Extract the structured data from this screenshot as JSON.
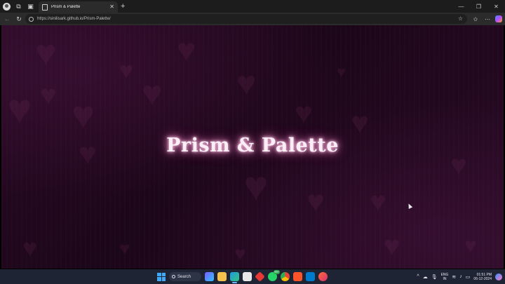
{
  "browser": {
    "tab_title": "Prism & Palette",
    "tab_favicon": "page-icon",
    "url": "https://sinilisark.github.io/Prism-Palette/",
    "new_tab_label": "+"
  },
  "page": {
    "headline": "Prism & Palette"
  },
  "taskbar": {
    "search_label": "Search",
    "badge_count": "99+",
    "language_line1": "ENG",
    "language_line2": "IN",
    "time": "01:51 PM",
    "date": "06-12-2024"
  },
  "colors": {
    "page_background": "#1c0619",
    "headline_glow": "#ff9fd2",
    "taskbar": "#1e2433"
  }
}
